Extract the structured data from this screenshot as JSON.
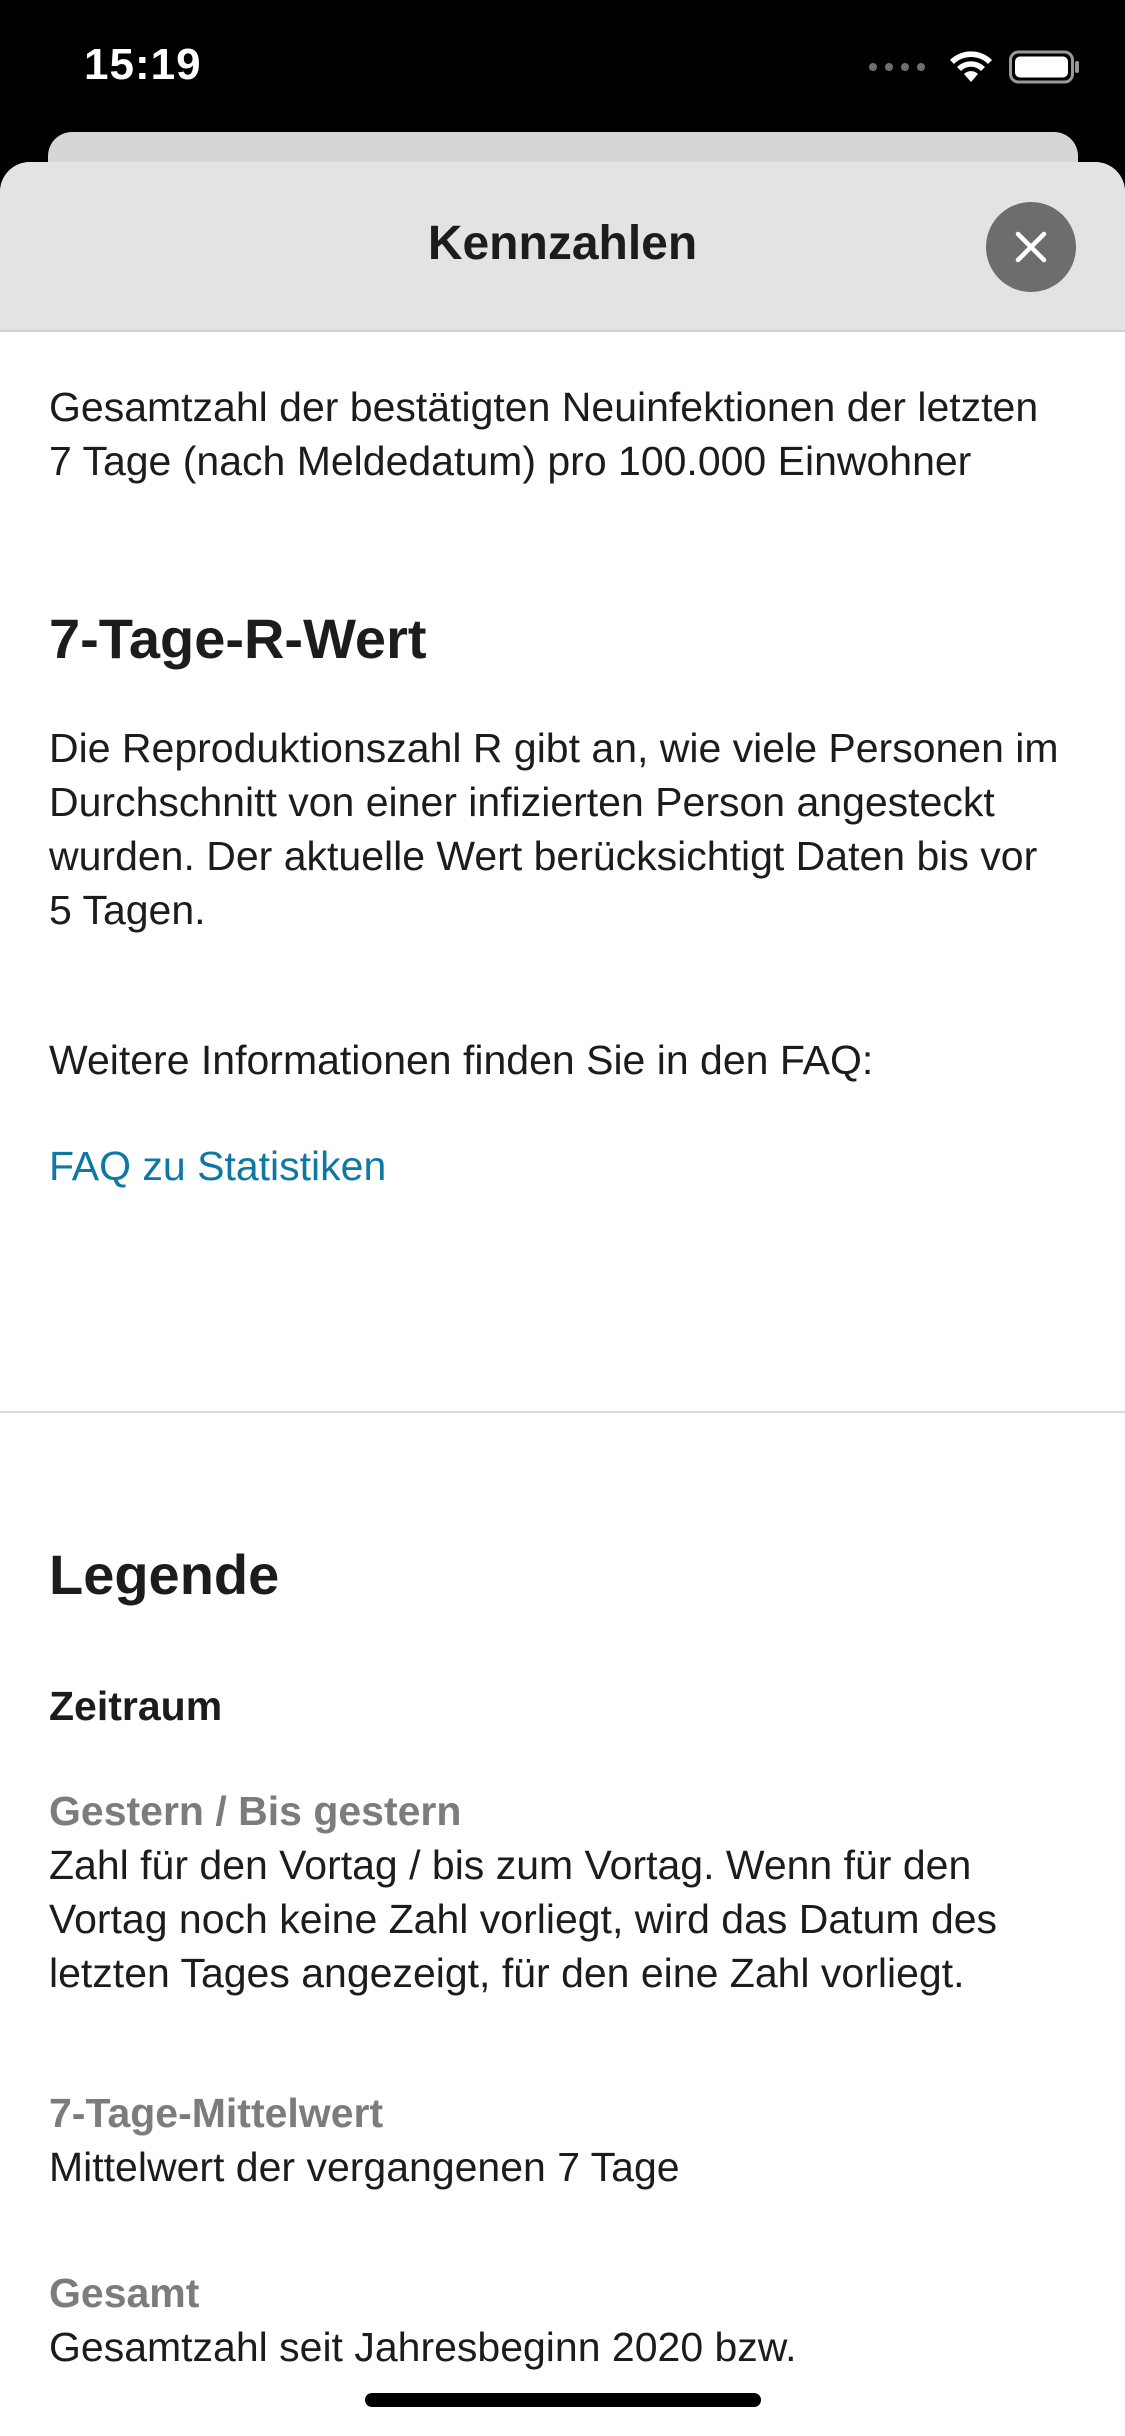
{
  "status_bar": {
    "time": "15:19"
  },
  "sheet": {
    "title": "Kennzahlen",
    "close_icon": "close-icon"
  },
  "content": {
    "incidence_description": "Gesamtzahl der bestätigten Neuinfektionen der letzten 7 Tage (nach Meldedatum) pro 100.000 Einwohner",
    "r_value_heading": "7-Tage-R-Wert",
    "r_value_description": "Die Reproduktionszahl R gibt an, wie viele Personen im Durchschnitt von einer infizierten Person angesteckt wurden. Der aktuelle Wert berücksichtigt Daten bis vor 5 Tagen.",
    "faq_intro": "Weitere Informationen finden Sie in den FAQ:",
    "faq_link": "FAQ zu Statistiken",
    "legend_heading": "Legende",
    "period_heading": "Zeitraum",
    "legend_items": [
      {
        "term": "Gestern / Bis gestern",
        "description": "Zahl für den Vortag / bis zum Vortag. Wenn für den Vortag noch keine Zahl vorliegt, wird das Datum des letzten Tages angezeigt, für den eine Zahl vorliegt."
      },
      {
        "term": "7-Tage-Mittelwert",
        "description": "Mittelwert der vergangenen 7 Tage"
      },
      {
        "term": "Gesamt",
        "description": "Gesamtzahl seit Jahresbeginn 2020 bzw."
      }
    ]
  },
  "colors": {
    "link": "#0e78a4",
    "muted": "#7c7c7c",
    "header_bg": "#e3e3e3",
    "close_bg": "#6d6d6d"
  }
}
